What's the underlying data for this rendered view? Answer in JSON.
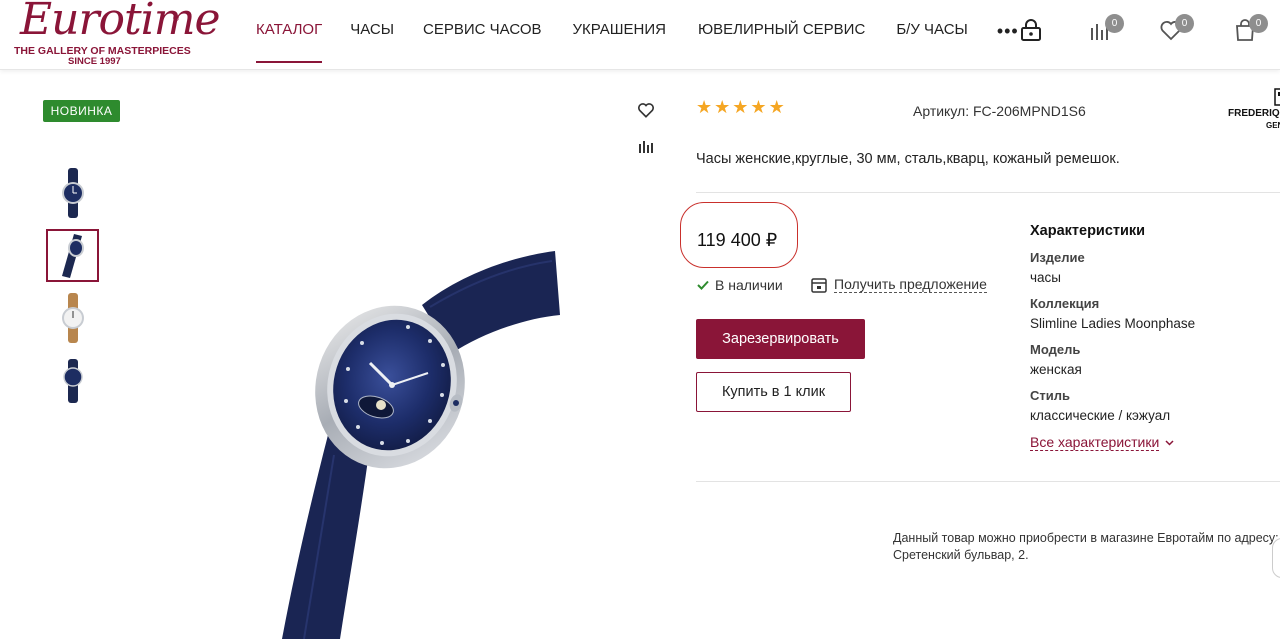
{
  "header": {
    "logo": {
      "script": "Eurotime",
      "registered": "®",
      "tagline": "THE GALLERY OF MASTERPIECES",
      "since": "SINCE 1997"
    },
    "nav": [
      {
        "label": "КАТАЛОГ",
        "active": true
      },
      {
        "label": "ЧАСЫ",
        "active": false
      },
      {
        "label": "СЕРВИС ЧАСОВ",
        "active": false
      },
      {
        "label": "УКРАШЕНИЯ",
        "active": false
      },
      {
        "label": "ЮВЕЛИРНЫЙ СЕРВИС",
        "active": false
      },
      {
        "label": "Б/У ЧАСЫ",
        "active": false
      }
    ],
    "more": "•••",
    "icons": {
      "lock": "lock-icon",
      "compare": {
        "icon": "compare-icon",
        "count": "0"
      },
      "favorites": {
        "icon": "heart-icon",
        "count": "0"
      },
      "cart": {
        "icon": "shopping-bag-icon",
        "count": "0"
      }
    }
  },
  "gallery": {
    "badge": "НОВИНКА",
    "thumbnails": [
      {
        "name": "watch-front-view",
        "active": false
      },
      {
        "name": "watch-side-view",
        "active": true
      },
      {
        "name": "watch-brown-strap-view",
        "active": false
      },
      {
        "name": "watch-back-view",
        "active": false
      }
    ]
  },
  "product": {
    "rating": 5,
    "sku": "Артикул: FC-206MPND1S6",
    "brand": {
      "name": "FREDERIQUE CONSTANT",
      "sub": "GENEVE"
    },
    "description": "Часы женские,круглые, 30 мм, сталь,кварц, кожаный ремешок.",
    "price": "119 400 ₽",
    "stock": "В наличии",
    "offer": "Получить предложение",
    "reserve_button": "Зарезервировать",
    "oneclick_button": "Купить в 1 клик",
    "store_note": "Данный товар можно приобрести в магазине Евротайм по адресу: Сретенский бульвар, 2."
  },
  "specs": {
    "title": "Характеристики",
    "items": [
      {
        "name": "Изделие",
        "value": "часы"
      },
      {
        "name": "Коллекция",
        "value": "Slimline Ladies Moonphase"
      },
      {
        "name": "Модель",
        "value": "женская"
      },
      {
        "name": "Стиль",
        "value": "классические / кэжуал"
      }
    ],
    "all_link": "Все характеристики"
  },
  "colors": {
    "accent": "#8a1538",
    "new_badge": "#2e8b2e",
    "star": "#f5a623",
    "stock_check": "#2e8b2e",
    "price_ring": "#c9302c"
  }
}
